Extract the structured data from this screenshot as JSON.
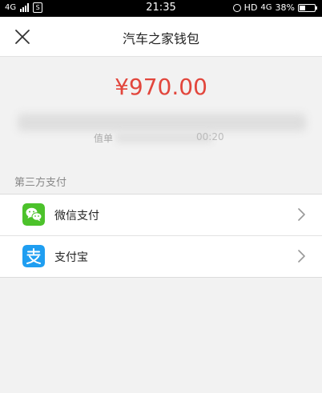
{
  "status_bar": {
    "network_left": "4G",
    "sim_icon_letter": "S",
    "time": "21:35",
    "hd": "HD",
    "network_right": "4G",
    "battery": "38%",
    "battery_level": 0.38
  },
  "header": {
    "close_icon": "close-icon",
    "title": "汽车之家钱包"
  },
  "balance": {
    "amount": "¥970.00",
    "sub_prefix": "值单",
    "sub_suffix": "00:20"
  },
  "section": {
    "label": "第三方支付"
  },
  "payment_methods": [
    {
      "label": "微信支付",
      "icon": "wechat-icon",
      "color": "#4cc22b"
    },
    {
      "label": "支付宝",
      "icon": "alipay-icon",
      "color": "#1f9ef1"
    }
  ],
  "colors": {
    "amount": "#e2463c",
    "background": "#f2f2f2"
  }
}
